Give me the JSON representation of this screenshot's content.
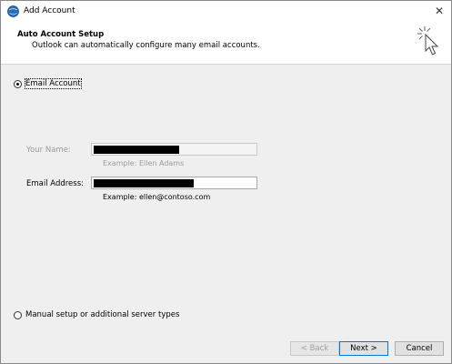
{
  "window": {
    "title": "Add Account",
    "close_glyph": "✕"
  },
  "header": {
    "title": "Auto Account Setup",
    "subtitle": "Outlook can automatically configure many email accounts."
  },
  "options": {
    "email_account": {
      "label": "Email Account",
      "selected": true
    },
    "manual_setup": {
      "label": "Manual setup or additional server types",
      "selected": false
    }
  },
  "form": {
    "your_name": {
      "label": "Your Name:",
      "example": "Example: Ellen Adams",
      "enabled": false,
      "value_redacted": true
    },
    "email_address": {
      "label": "Email Address:",
      "example": "Example: ellen@contoso.com",
      "enabled": true,
      "value_redacted": true
    }
  },
  "buttons": {
    "back": "< Back",
    "next": "Next >",
    "cancel": "Cancel"
  },
  "icons": {
    "app": "outlook-globe-icon",
    "header": "sparkle-cursor-icon"
  }
}
